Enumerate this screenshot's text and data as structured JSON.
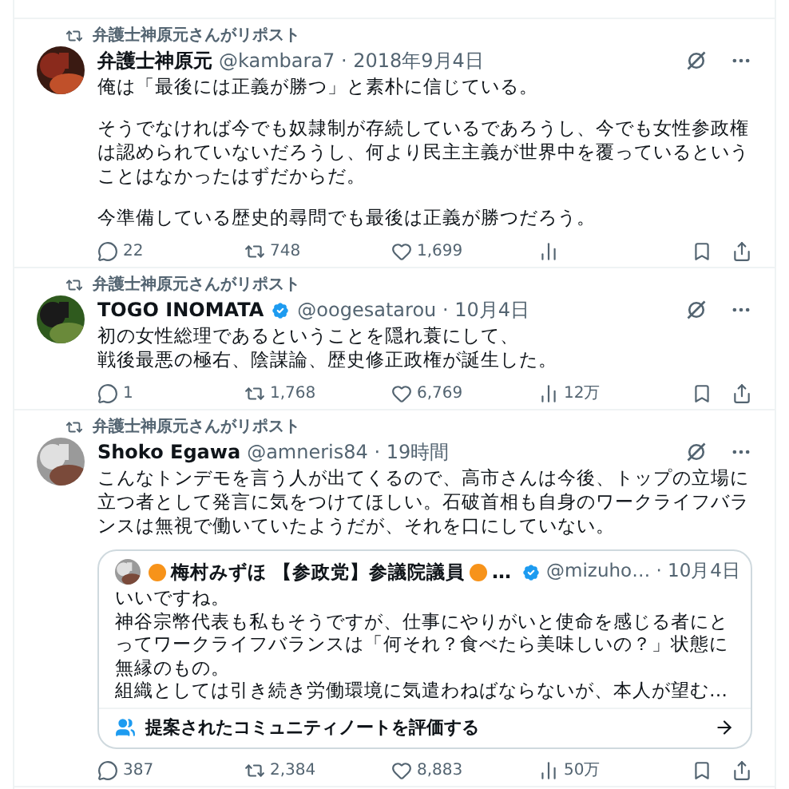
{
  "tweets": [
    {
      "repost_label": "弁護士神原元さんがリポスト",
      "name": "弁護士神原元",
      "verified": false,
      "meta": "@kambara7 · 2018年9月4日",
      "paragraphs": [
        [
          "俺は「最後には正義が勝つ」と素朴に信じている。"
        ],
        [
          "そうでなければ今でも奴隷制が存続しているであろうし、今でも女性参政権は認められていないだろうし、何より民主主義が世界中を覆っているということはなかったはずだからだ。"
        ],
        [
          "今準備している歴史的尋問でも最後は正義が勝つだろう。"
        ]
      ],
      "stats": {
        "replies": "22",
        "reposts": "748",
        "likes": "1,699"
      }
    },
    {
      "repost_label": "弁護士神原元さんがリポスト",
      "name": "TOGO INOMATA",
      "verified": true,
      "meta": "@oogesatarou · 10月4日",
      "paragraphs": [
        [
          "初の女性総理であるということを隠れ蓑にして、",
          "戦後最悪の極右、陰謀論、歴史修正政権が誕生した。"
        ]
      ],
      "stats": {
        "replies": "1",
        "reposts": "1,768",
        "likes": "6,769",
        "views": "12万"
      }
    },
    {
      "repost_label": "弁護士神原元さんがリポスト",
      "name": "Shoko Egawa",
      "verified": false,
      "meta": "@amneris84 · 19時間",
      "paragraphs": [
        [
          "こんなトンデモを言う人が出てくるので、高市さんは今後、トップの立場に立つ者として発言に気をつけてほしい。石破首相も自身のワークライフバランスは無視で働いていたようだが、それを口にしていない。"
        ]
      ],
      "quote": {
        "name": "梅村みずほ 【参政党】参議院議員",
        "name_suffix": "…",
        "verified": true,
        "meta": "@mizuho… · 10月4日",
        "lines": [
          "いいですね。",
          "神谷宗幣代表も私もそうですが、仕事にやりがいと使命を感じる者にとってワークライフバランスは「何それ？食べたら美味しいの？」状態に無縁のもの。",
          "組織としては引き続き労働環境に気遣わねばならないが、本人が望む…"
        ],
        "community_note": "提案されたコミュニティノートを評価する"
      },
      "stats": {
        "replies": "387",
        "reposts": "2,384",
        "likes": "8,883",
        "views": "50万"
      }
    }
  ]
}
